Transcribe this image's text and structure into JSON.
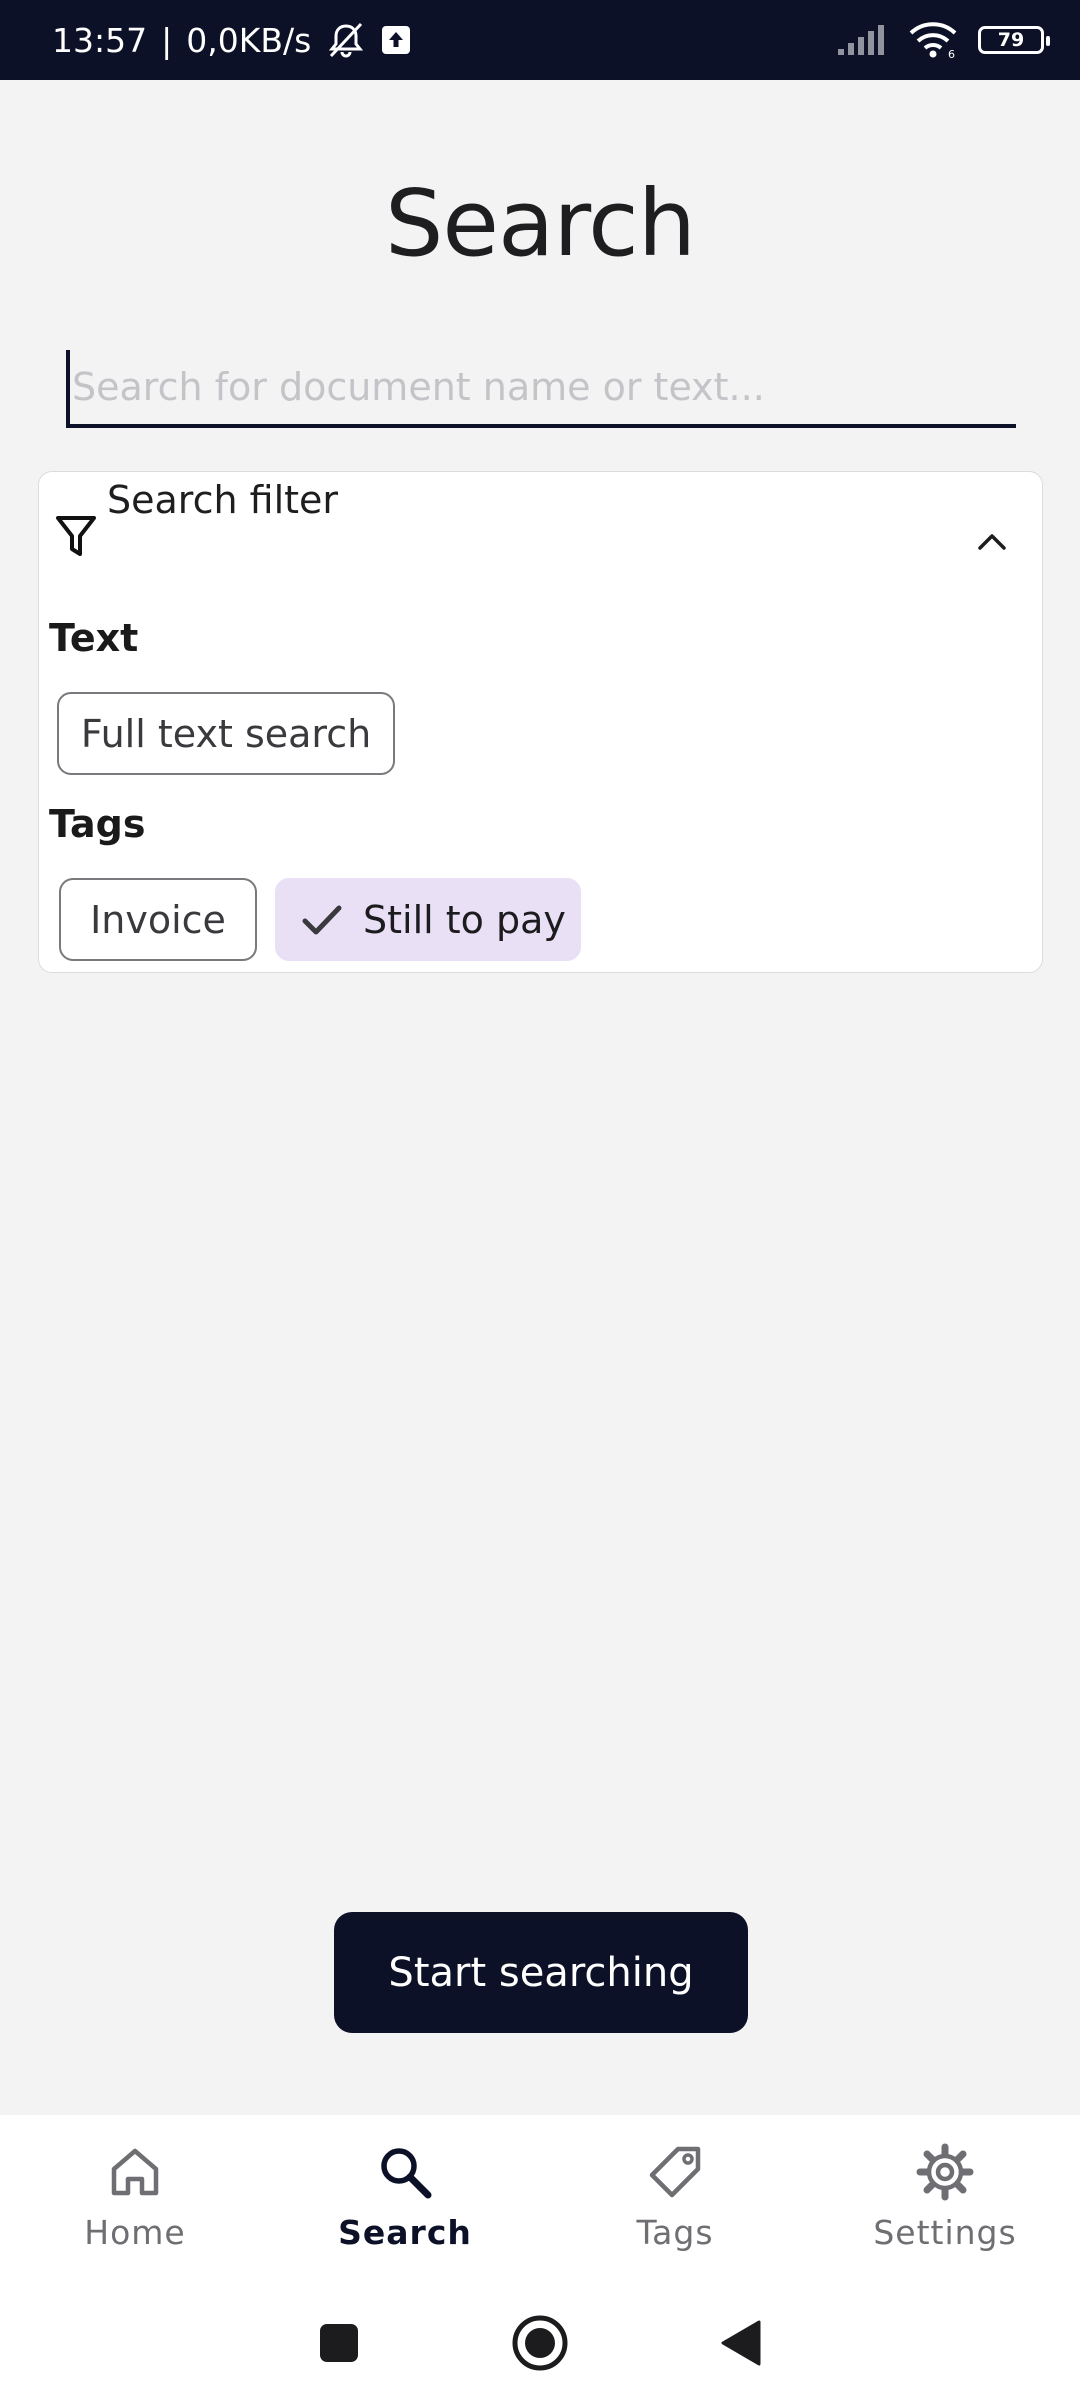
{
  "status_bar": {
    "time": "13:57",
    "separator": "|",
    "speed": "0,0KB/s",
    "battery": "79",
    "wifi_badge": "6"
  },
  "page": {
    "title": "Search"
  },
  "search": {
    "placeholder": "Search for document name or text...",
    "value": ""
  },
  "filter": {
    "title": "Search filter",
    "text_section": {
      "label": "Text",
      "chips": [
        "Full text search"
      ]
    },
    "tags_section": {
      "label": "Tags",
      "chips": [
        "Invoice",
        "Still to pay"
      ],
      "selected": [
        "Still to pay"
      ]
    }
  },
  "actions": {
    "start_label": "Start searching"
  },
  "bottom_nav": {
    "items": [
      {
        "label": "Home",
        "icon": "home-icon"
      },
      {
        "label": "Search",
        "icon": "search-icon",
        "active": true
      },
      {
        "label": "Tags",
        "icon": "tag-icon"
      },
      {
        "label": "Settings",
        "icon": "gear-icon"
      }
    ]
  },
  "colors": {
    "primary": "#0c1128",
    "selected_chip": "#e9e0f6",
    "background": "#f3f3f4"
  }
}
